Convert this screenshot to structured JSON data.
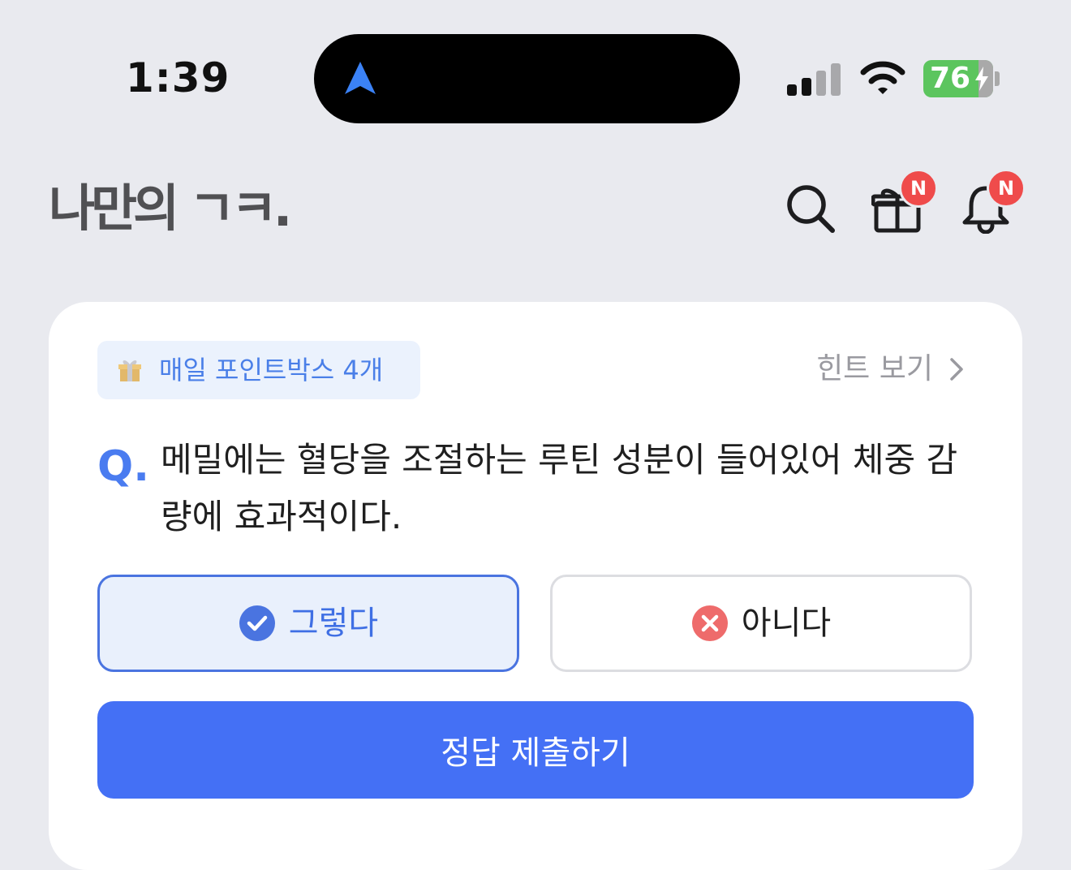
{
  "status_bar": {
    "time": "1:39",
    "battery_percent": "76",
    "colors": {
      "battery": "#5cc55e",
      "nav_arrow": "#3b82f6"
    }
  },
  "header": {
    "logo_text": "나만의 ㄱㅋ.",
    "icons": [
      "search-icon",
      "gift-icon",
      "bell-icon"
    ],
    "gift_badge": "N",
    "bell_badge": "N",
    "colors": {
      "badge": "#ef4b4b"
    }
  },
  "quiz": {
    "point_chip": "매일 포인트박스 4개",
    "hint_label": "힌트 보기",
    "q_prefix": "Q.",
    "question": "메밀에는 혈당을 조절하는 루틴 성분이 들어있어 체중 감량에 효과적이다.",
    "options": [
      {
        "label": "그렇다",
        "selected": true,
        "icon": "check-circle-icon"
      },
      {
        "label": "아니다",
        "selected": false,
        "icon": "x-circle-icon"
      }
    ],
    "submit_label": "정답 제출하기",
    "colors": {
      "primary": "#4470f5",
      "selected_bg": "#e9f0fc",
      "no_icon": "#ee6b6b"
    }
  }
}
